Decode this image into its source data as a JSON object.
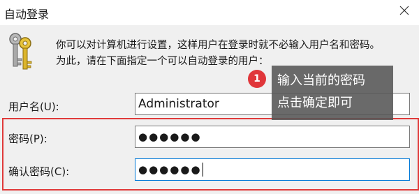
{
  "window": {
    "title": "自动登录",
    "close_glyph": "✕"
  },
  "description": {
    "line1": "你可以对计算机进行设置，这样用户在登录时就不必输入用户名和密码。",
    "line2": "为此，请在下面指定一个可以自动登录的用户："
  },
  "form": {
    "username_label": "用户名(U):",
    "username_value": "Administrator",
    "password_label": "密码(P):",
    "password_mask": "●●●●●●",
    "confirm_label": "确认密码(C):",
    "confirm_mask": "●●●●●●"
  },
  "annotation": {
    "badge_number": "1",
    "line1": "输入当前的密码",
    "line2": "点击确定即可"
  },
  "colors": {
    "highlight_frame": "#e03a3a",
    "badge": "#e0363a",
    "focus_border": "#0078d7",
    "callout_bg": "#555555"
  },
  "icons": {
    "app_icon": "keys-icon",
    "close": "close-icon"
  }
}
